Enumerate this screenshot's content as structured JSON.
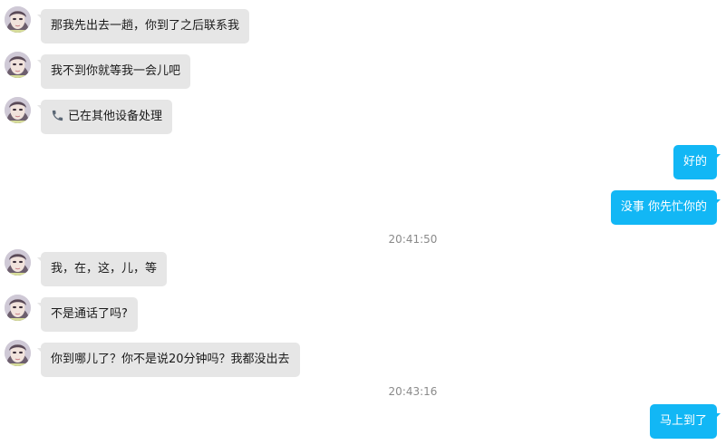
{
  "messages": [
    {
      "text": "那我先出去一趟，你到了之后联系我"
    },
    {
      "text": "我不到你就等我一会儿吧"
    },
    {
      "text": "已在其他设备处理",
      "icon": "phone-icon"
    },
    {
      "text": "好的"
    },
    {
      "text": "没事 你先忙你的"
    },
    {
      "text": "我，在，这，儿，等"
    },
    {
      "text": "不是通话了吗?"
    },
    {
      "text": "你到哪儿了？你不是说20分钟吗？我都没出去"
    },
    {
      "text": "马上到了"
    }
  ],
  "timestamps": [
    "20:41:50",
    "20:43:16"
  ],
  "colors": {
    "incoming_bubble": "#e6e6e6",
    "outgoing_bubble": "#12b7f5",
    "timestamp": "#8a8a8a"
  }
}
